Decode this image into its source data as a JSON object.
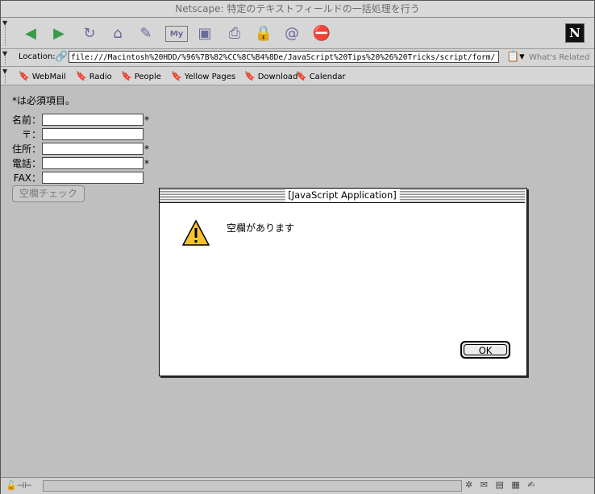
{
  "window": {
    "title": "Netscape: 特定のテキストフィールドの一括処理を行う"
  },
  "toolbar": {
    "buttons": [
      {
        "name": "back",
        "icon": "◀",
        "color": "#3a9a4a"
      },
      {
        "name": "forward",
        "icon": "▶",
        "color": "#3a9a4a"
      },
      {
        "name": "reload",
        "icon": "↻",
        "color": "#6a6a9a"
      },
      {
        "name": "home",
        "icon": "⌂",
        "color": "#6a6a9a"
      },
      {
        "name": "search",
        "icon": "✎",
        "color": "#6a6a9a"
      },
      {
        "name": "my-netscape",
        "icon": "My",
        "color": "#6a6a9a"
      },
      {
        "name": "images",
        "icon": "▣",
        "color": "#6a6a9a"
      },
      {
        "name": "print",
        "icon": "⎙",
        "color": "#6a6a9a"
      },
      {
        "name": "security",
        "icon": "🔒",
        "color": "#aa3333"
      },
      {
        "name": "shop",
        "icon": "@",
        "color": "#6a6a9a"
      },
      {
        "name": "stop",
        "icon": "⛔",
        "color": "#aa3333"
      }
    ],
    "logo": "N"
  },
  "location": {
    "label": "Location:",
    "url": "file:///Macintosh%20HDD/%96%7B%82%CC%8C%B4%8De/JavaScript%20Tips%20%26%20Tricks/script/form/",
    "related": "What's Related"
  },
  "personal_toolbar": {
    "items": [
      "WebMail",
      "Radio",
      "People",
      "Yellow Pages",
      "Download",
      "Calendar"
    ]
  },
  "page": {
    "note": "*は必須項目。",
    "fields": [
      {
        "label": "名前：",
        "required": "*"
      },
      {
        "label": "〒：",
        "required": ""
      },
      {
        "label": "住所：",
        "required": "*"
      },
      {
        "label": "電話：",
        "required": "*"
      },
      {
        "label": "FAX：",
        "required": ""
      }
    ],
    "check_button": "空欄チェック"
  },
  "dialog": {
    "title": "[JavaScript Application]",
    "message": "空欄があります",
    "ok_label": "OK",
    "icon": "warning-icon"
  }
}
